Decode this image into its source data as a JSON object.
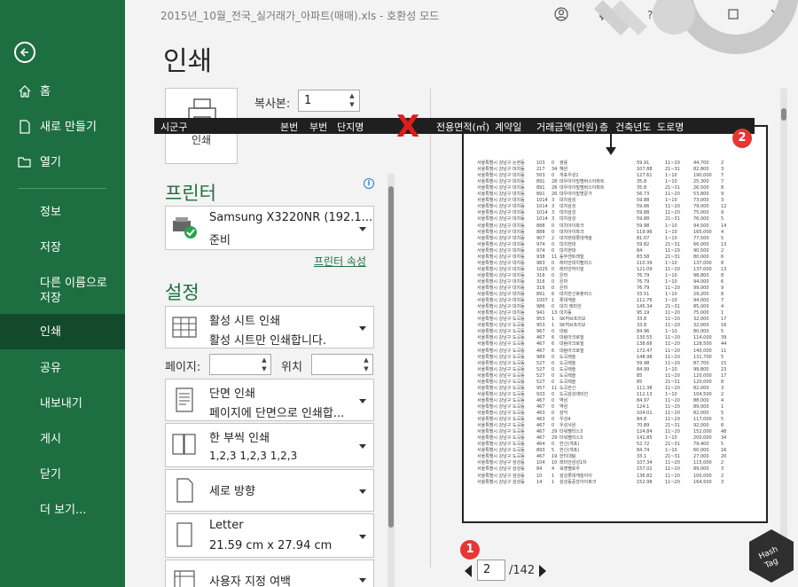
{
  "window": {
    "title": "2015년_10월_전국_실거래가_아파트(매매).xls  -  호환성 모드"
  },
  "nav": {
    "back_icon": "back-arrow-icon",
    "items": [
      {
        "label": "홈",
        "icon": "home-icon"
      },
      {
        "label": "새로 만들기",
        "icon": "new-file-icon"
      },
      {
        "label": "열기",
        "icon": "folder-open-icon"
      },
      {
        "label": "정보"
      },
      {
        "label": "저장"
      },
      {
        "label": "다른 이름으로 저장"
      },
      {
        "label": "인쇄",
        "active": true
      },
      {
        "label": "공유"
      },
      {
        "label": "내보내기"
      },
      {
        "label": "게시"
      },
      {
        "label": "닫기"
      },
      {
        "label": "더 보기..."
      }
    ]
  },
  "print": {
    "title": "인쇄",
    "print_button": "인쇄",
    "copies_label": "복사본:",
    "copies_value": "1",
    "printer_heading": "프린터",
    "printer_name": "Samsung X3220NR (192.1...",
    "printer_status": "준비",
    "printer_props": "프린터 속성",
    "settings_heading": "설정",
    "s1_title": "활성 시트 인쇄",
    "s1_sub": "활성 시트만 인쇄합니다.",
    "pages_label": "페이지:",
    "position_label": "위치",
    "s2_title": "단면 인쇄",
    "s2_sub": "페이지에 단면으로 인쇄합...",
    "s3_title": "한 부씩 인쇄",
    "s3_sub": "1,2,3     1,2,3     1,2,3",
    "s4_title": "세로 방향",
    "s5_title": "Letter",
    "s5_sub": "21.59 cm x 27.94 cm",
    "s6_title": "사용자 지정 여백"
  },
  "preview": {
    "header_cols": [
      "시군구",
      "본번",
      "부번",
      "단지명",
      "전용면적(㎡)",
      "계약일",
      "거래금액(만원)",
      "층",
      "건축년도",
      "도로명"
    ],
    "x_mark": "X",
    "badge1": "1",
    "badge2": "2",
    "page_current": "2",
    "page_total": "/142",
    "rows": [
      [
        "서울특별시 강남구 논현동",
        "103",
        "0",
        "쌍용",
        "59.91",
        "11~20",
        "44,700",
        "2"
      ],
      [
        "서울특별시 강남구 대치동",
        "217",
        "34",
        "혜원",
        "107.88",
        "21~31",
        "82,800",
        "3"
      ],
      [
        "서울특별시 강남구 대치동",
        "503",
        "0",
        "개포우성1",
        "127.61",
        "1~10",
        "190,000",
        "7"
      ],
      [
        "서울특별시 강남구 대치동",
        "891",
        "28",
        "대우아이빌멤버스아파트",
        "35.8",
        "1~10",
        "25,300",
        "7"
      ],
      [
        "서울특별시 강남구 대치동",
        "891",
        "28",
        "대우아이빌멤버스아파트",
        "35.8",
        "21~31",
        "26,500",
        "8"
      ],
      [
        "서울특별시 강남구 대치동",
        "891",
        "26",
        "대우아이빌명문가",
        "56.73",
        "11~20",
        "53,800",
        "9"
      ],
      [
        "서울특별시 강남구 대치동",
        "1014",
        "3",
        "대치삼성",
        "59.88",
        "1~10",
        "73,000",
        "3"
      ],
      [
        "서울특별시 강남구 대치동",
        "1014",
        "3",
        "대치삼성",
        "59.86",
        "11~20",
        "79,000",
        "12"
      ],
      [
        "서울특별시 강남구 대치동",
        "1014",
        "3",
        "대치삼성",
        "59.88",
        "11~20",
        "75,000",
        "9"
      ],
      [
        "서울특별시 강남구 대치동",
        "1014",
        "3",
        "대치삼성",
        "59.88",
        "21~31",
        "76,000",
        "5"
      ],
      [
        "서울특별시 강남구 대치동",
        "888",
        "0",
        "대치아이파크",
        "59.98",
        "1~10",
        "94,500",
        "14"
      ],
      [
        "서울특별시 강남구 대치동",
        "888",
        "0",
        "대치아이파크",
        "119.96",
        "1~10",
        "165,000",
        "4"
      ],
      [
        "서울특별시 강남구 대치동",
        "907",
        "2",
        "대치현대롯데캐슬",
        "81.07",
        "1~10",
        "77,500",
        "5"
      ],
      [
        "서울특별시 강남구 대치동",
        "974",
        "0",
        "대치현대",
        "59.82",
        "21~31",
        "66,000",
        "13"
      ],
      [
        "서울특별시 강남구 대치동",
        "974",
        "0",
        "대치현대",
        "84",
        "11~20",
        "90,500",
        "2"
      ],
      [
        "서울특별시 강남구 대치동",
        "938",
        "11",
        "동부센트레빌",
        "83.58",
        "21~31",
        "80,000",
        "6"
      ],
      [
        "서울특별시 강남구 대치동",
        "983",
        "0",
        "래미안대치팰리스",
        "110.39",
        "1~10",
        "137,000",
        "8"
      ],
      [
        "서울특별시 강남구 대치동",
        "1025",
        "0",
        "래미안하이빌",
        "121.09",
        "11~20",
        "137,000",
        "13"
      ],
      [
        "서울특별시 강남구 대치동",
        "316",
        "0",
        "은마",
        "76.79",
        "1~10",
        "98,800",
        "8"
      ],
      [
        "서울특별시 강남구 대치동",
        "316",
        "0",
        "은마",
        "76.79",
        "1~10",
        "94,000",
        "6"
      ],
      [
        "서울특별시 강남구 대치동",
        "316",
        "0",
        "은마",
        "76.79",
        "11~20",
        "99,000",
        "9"
      ],
      [
        "서울특별시 강남구 대치동",
        "891",
        "6",
        "대치한신휴플러스",
        "33.51",
        "1~10",
        "29,200",
        "8"
      ],
      [
        "서울특별시 강남구 대치동",
        "1007",
        "1",
        "롯데캐슬",
        "111.76",
        "1~10",
        "94,000",
        "7"
      ],
      [
        "서울특별시 강남구 대치동",
        "986",
        "0",
        "대치 래미안",
        "145.34",
        "21~31",
        "85,000",
        "4"
      ],
      [
        "서울특별시 강남구 대치동",
        "941",
        "13",
        "대치동",
        "95.19",
        "11~20",
        "75,000",
        "1"
      ],
      [
        "서울특별시 강남구 도곡동",
        "953",
        "1",
        "SK허브프리모",
        "33.8",
        "11~20",
        "32,000",
        "17"
      ],
      [
        "서울특별시 강남구 도곡동",
        "953",
        "1",
        "SK허브프리모",
        "33.8",
        "11~20",
        "32,000",
        "16"
      ],
      [
        "서울특별시 강남구 도곡동",
        "967",
        "0",
        "대림",
        "84.96",
        "1~10",
        "80,000",
        "5"
      ],
      [
        "서울특별시 강남구 도곡동",
        "467",
        "6",
        "대림아크로빌",
        "130.55",
        "11~20",
        "114,000",
        "39"
      ],
      [
        "서울특별시 강남구 도곡동",
        "467",
        "6",
        "대림아크로빌",
        "138.66",
        "11~20",
        "128,500",
        "44"
      ],
      [
        "서울특별시 강남구 도곡동",
        "467",
        "6",
        "대림아크로빌",
        "172.47",
        "11~20",
        "140,000",
        "11"
      ],
      [
        "서울특별시 강남구 도곡동",
        "989",
        "0",
        "도곡렉슬",
        "148.98",
        "11~20",
        "131,700",
        "5"
      ],
      [
        "서울특별시 강남구 도곡동",
        "527",
        "0",
        "도곡렉슬",
        "59.98",
        "11~20",
        "87,700",
        "15"
      ],
      [
        "서울특별시 강남구 도곡동",
        "527",
        "0",
        "도곡렉슬",
        "84.99",
        "1~10",
        "99,800",
        "23"
      ],
      [
        "서울특별시 강남구 도곡동",
        "527",
        "0",
        "도곡렉슬",
        "85",
        "11~20",
        "120,000",
        "17"
      ],
      [
        "서울특별시 강남구 도곡동",
        "527",
        "0",
        "도곡렉슬",
        "85",
        "21~31",
        "120,000",
        "8"
      ],
      [
        "서울특별시 강남구 도곡동",
        "957",
        "11",
        "도곡한신",
        "111.38",
        "11~20",
        "82,000",
        "3"
      ],
      [
        "서울특별시 강남구 도곡동",
        "933",
        "0",
        "도곡삼성래미안",
        "112.13",
        "1~10",
        "104,500",
        "2"
      ],
      [
        "서울특별시 강남구 도곡동",
        "467",
        "0",
        "역삼",
        "84.97",
        "11~20",
        "88,000",
        "4"
      ],
      [
        "서울특별시 강남구 도곡동",
        "467",
        "0",
        "역삼",
        "124.1",
        "11~20",
        "89,000",
        "1"
      ],
      [
        "서울특별시 강남구 도곡동",
        "463",
        "0",
        "삼익",
        "104.01",
        "11~20",
        "82,000",
        "5"
      ],
      [
        "서울특별시 강남구 도곡동",
        "463",
        "0",
        "우성4",
        "84.8",
        "11~20",
        "117,000",
        "5"
      ],
      [
        "서울특별시 강남구 도곡동",
        "467",
        "0",
        "우성사원",
        "70.89",
        "21~31",
        "92,000",
        "8"
      ],
      [
        "서울특별시 강남구 도곡동",
        "467",
        "29",
        "타워팰리스3",
        "124.84",
        "11~20",
        "152,000",
        "48"
      ],
      [
        "서울특별시 강남구 도곡동",
        "467",
        "29",
        "타워팰리스3",
        "141.85",
        "1~10",
        "200,000",
        "34"
      ],
      [
        "서울특별시 강남구 도곡동",
        "464",
        "0",
        "한신(개포)",
        "52.72",
        "21~31",
        "79,400",
        "5"
      ],
      [
        "서울특별시 강남구 도곡동",
        "893",
        "5",
        "한신(개포)",
        "84.74",
        "1~10",
        "60,000",
        "16"
      ],
      [
        "서울특별시 강남구 도곡동",
        "467",
        "19",
        "한티대림",
        "33.1",
        "21~31",
        "27,000",
        "20"
      ],
      [
        "서울특별시 강남구 삼성동",
        "104",
        "10",
        "래미안삼성1차",
        "107.34",
        "11~20",
        "115,000",
        "2"
      ],
      [
        "서울특별시 강남구 삼성동",
        "84",
        "4",
        "북영팰로우",
        "157.02",
        "11~20",
        "89,000",
        "3"
      ],
      [
        "서울특별시 강남구 삼성동",
        "10",
        "1",
        "삼성롯데캐슬아이",
        "136.82",
        "11~20",
        "100,000",
        "2"
      ],
      [
        "서울특별시 강남구 삼성동",
        "14",
        "1",
        "삼성동중앙아이파크",
        "152.98",
        "11~20",
        "164,500",
        "3"
      ]
    ]
  },
  "colors": {
    "nav_bg": "#1d6f42",
    "nav_active": "#134a2c",
    "accent_green": "#1d6f42",
    "badge_red": "#e63535"
  }
}
